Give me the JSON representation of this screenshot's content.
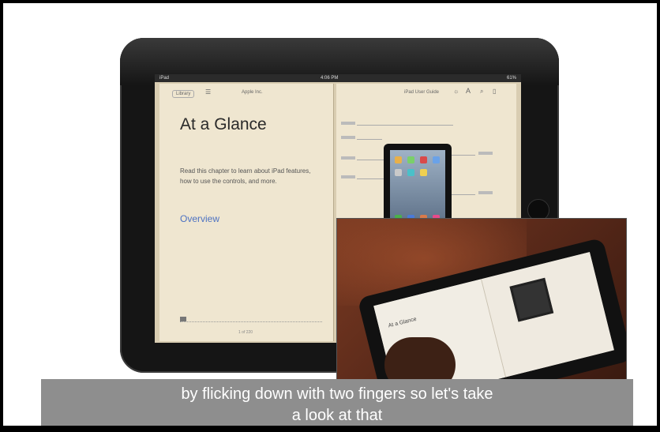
{
  "status": {
    "carrier": "iPad",
    "time": "4:06 PM",
    "battery": "61%"
  },
  "toolbar": {
    "library_label": "Library",
    "book_title": "Apple Inc.",
    "guide_title": "iPad User Guide"
  },
  "left_page": {
    "chapter_title": "At a Glance",
    "intro": "Read this chapter to learn about iPad features, how to use the controls, and more.",
    "link": "Overview",
    "page_label": "1 of 220"
  },
  "video": {
    "chapter_title": "At a Glance"
  },
  "subtitle": {
    "line1": "by flicking down with two fingers so let's take",
    "line2": "a look at that"
  },
  "colors": {
    "link": "#4d72c2",
    "page": "#efe6d0",
    "caption_bg": "#8e8e8e"
  }
}
